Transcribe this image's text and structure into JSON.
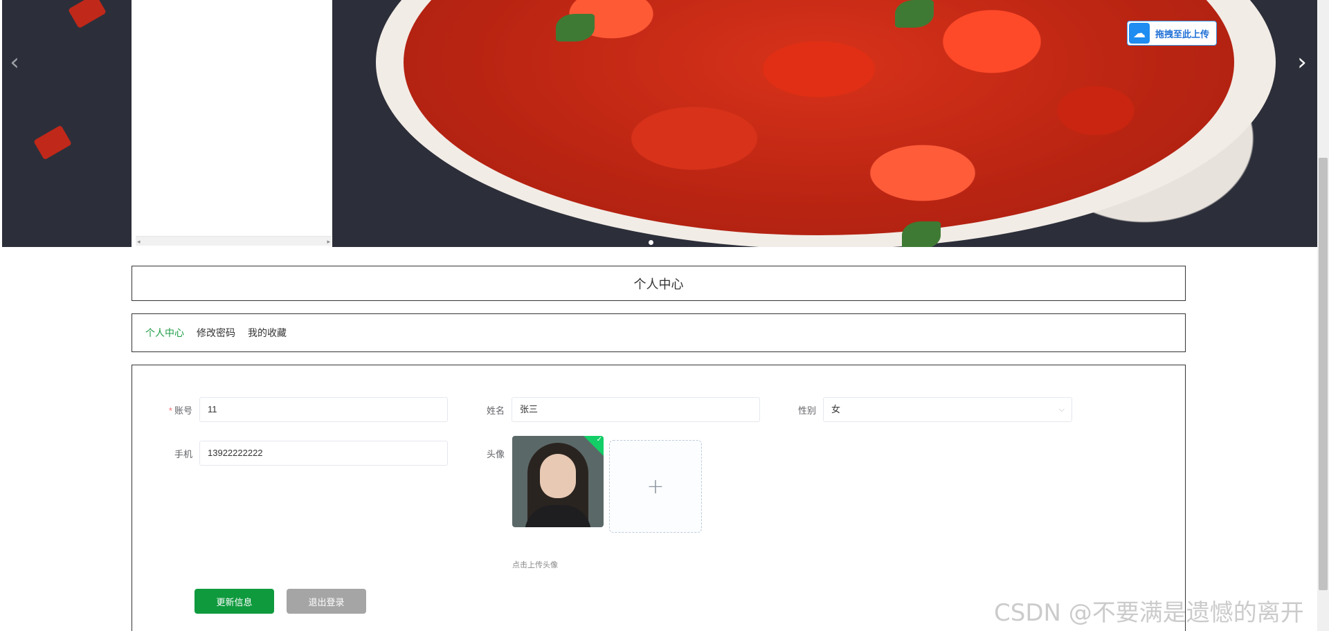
{
  "banner": {
    "prev_icon": "chevron-left-icon",
    "next_icon": "chevron-right-icon",
    "prev_glyph": "‹",
    "next_glyph": "›",
    "upload_float_label": "拖拽至此上传",
    "upload_float_icon": "cloud-upload-icon",
    "scroll_left": "◂",
    "scroll_right": "▸"
  },
  "page_title": "个人中心",
  "tabs": [
    {
      "label": "个人中心",
      "active": true
    },
    {
      "label": "修改密码",
      "active": false
    },
    {
      "label": "我的收藏",
      "active": false
    }
  ],
  "form": {
    "account": {
      "label": "账号",
      "required_mark": "*",
      "value": "11"
    },
    "name": {
      "label": "姓名",
      "value": "张三"
    },
    "gender": {
      "label": "性别",
      "value": "女"
    },
    "phone": {
      "label": "手机",
      "value": "13922222222"
    },
    "avatar": {
      "label": "头像",
      "upload_plus": "+",
      "hint": "点击上传头像"
    }
  },
  "buttons": {
    "update": "更新信息",
    "logout": "退出登录"
  },
  "watermark": "CSDN @不要满是遗憾的离开",
  "colors": {
    "accent_green": "#0f9a3e",
    "active_tab": "#1d9b45",
    "logout_gray": "#a5a5a5",
    "required_red": "#f56c6c"
  }
}
